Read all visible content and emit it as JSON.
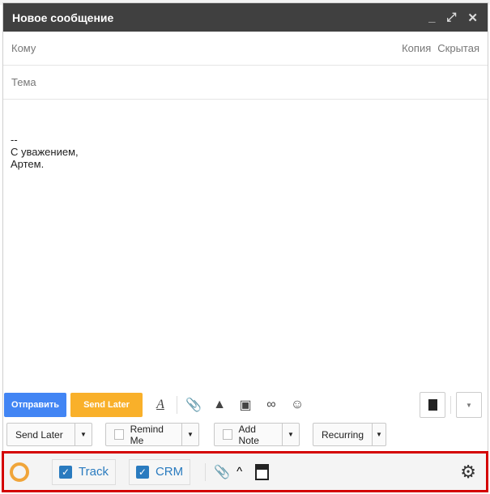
{
  "window": {
    "title": "Новое сообщение",
    "minimize": "_",
    "expand": "⤢",
    "close": "✕"
  },
  "to": {
    "label": "Кому",
    "cc": "Копия",
    "bcc": "Скрытая"
  },
  "subject": {
    "label": "Тема"
  },
  "body": {
    "lines": [
      "--",
      "С уважением,",
      "Артем."
    ]
  },
  "toolbar": {
    "send": "Отправить",
    "send_later": "Send Later"
  },
  "options": {
    "send_later": "Send Later",
    "remind_me": "Remind Me",
    "add_note": "Add Note",
    "recurring": "Recurring"
  },
  "bottom_bar": {
    "track": "Track",
    "crm": "CRM",
    "border_color": "#d40000"
  }
}
